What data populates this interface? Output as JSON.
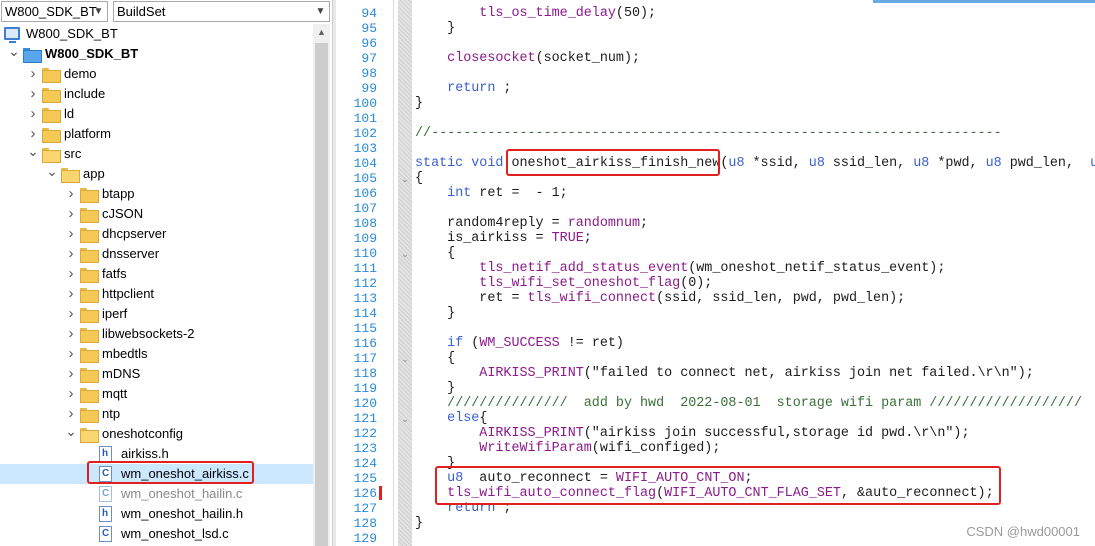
{
  "toolbar": {
    "project_combo": "W800_SDK_BT",
    "config_combo": "BuildSet"
  },
  "tree": [
    {
      "label": "W800_SDK_BT",
      "icon": "computer-icon",
      "expander": "",
      "indent": 0
    },
    {
      "label": "W800_SDK_BT",
      "icon": "project-folder-icon",
      "expander": "v",
      "indent": 0
    },
    {
      "label": "demo",
      "icon": "folder-icon",
      "expander": ">",
      "indent": 1
    },
    {
      "label": "include",
      "icon": "folder-icon",
      "expander": ">",
      "indent": 1
    },
    {
      "label": "ld",
      "icon": "folder-icon",
      "expander": ">",
      "indent": 1
    },
    {
      "label": "platform",
      "icon": "folder-icon",
      "expander": ">",
      "indent": 1
    },
    {
      "label": "src",
      "icon": "folder-open-icon",
      "expander": "v",
      "indent": 1
    },
    {
      "label": "app",
      "icon": "folder-open-icon",
      "expander": "v",
      "indent": 2
    },
    {
      "label": "btapp",
      "icon": "folder-icon",
      "expander": ">",
      "indent": 3
    },
    {
      "label": "cJSON",
      "icon": "folder-icon",
      "expander": ">",
      "indent": 3
    },
    {
      "label": "dhcpserver",
      "icon": "folder-icon",
      "expander": ">",
      "indent": 3
    },
    {
      "label": "dnsserver",
      "icon": "folder-icon",
      "expander": ">",
      "indent": 3
    },
    {
      "label": "fatfs",
      "icon": "folder-icon",
      "expander": ">",
      "indent": 3
    },
    {
      "label": "httpclient",
      "icon": "folder-icon",
      "expander": ">",
      "indent": 3
    },
    {
      "label": "iperf",
      "icon": "folder-icon",
      "expander": ">",
      "indent": 3
    },
    {
      "label": "libwebsockets-2",
      "icon": "folder-icon",
      "expander": ">",
      "indent": 3
    },
    {
      "label": "mbedtls",
      "icon": "folder-icon",
      "expander": ">",
      "indent": 3
    },
    {
      "label": "mDNS",
      "icon": "folder-icon",
      "expander": ">",
      "indent": 3
    },
    {
      "label": "mqtt",
      "icon": "folder-icon",
      "expander": ">",
      "indent": 3
    },
    {
      "label": "ntp",
      "icon": "folder-icon",
      "expander": ">",
      "indent": 3
    },
    {
      "label": "oneshotconfig",
      "icon": "folder-open-icon",
      "expander": "v",
      "indent": 3
    },
    {
      "label": "airkiss.h",
      "icon": "h-file-icon",
      "expander": "",
      "indent": 4
    },
    {
      "label": "wm_oneshot_airkiss.c",
      "icon": "c-file-icon",
      "expander": "",
      "indent": 4,
      "selected": true
    },
    {
      "label": "wm_oneshot_hailin.c",
      "icon": "c-file-muted-icon",
      "expander": "",
      "indent": 4,
      "muted": true
    },
    {
      "label": "wm_oneshot_hailin.h",
      "icon": "h-file-icon",
      "expander": "",
      "indent": 4
    },
    {
      "label": "wm_oneshot_lsd.c",
      "icon": "c-file-icon",
      "expander": "",
      "indent": 4
    }
  ],
  "editor": {
    "lines": [
      {
        "n": "94",
        "indent": "        ",
        "parts": [
          [
            "fn",
            "tls_os_time_delay"
          ],
          [
            "",
            "(50);"
          ]
        ]
      },
      {
        "n": "95",
        "indent": "    ",
        "parts": [
          [
            "",
            "}"
          ]
        ]
      },
      {
        "n": "96",
        "indent": "",
        "parts": []
      },
      {
        "n": "97",
        "indent": "    ",
        "parts": [
          [
            "fn",
            "closesocket"
          ],
          [
            "",
            "(socket_num);"
          ]
        ]
      },
      {
        "n": "98",
        "indent": "",
        "parts": []
      },
      {
        "n": "99",
        "indent": "    ",
        "parts": [
          [
            "kw",
            "return"
          ],
          [
            "",
            " ;"
          ]
        ]
      },
      {
        "n": "100",
        "indent": "",
        "parts": [
          [
            "",
            "}"
          ]
        ]
      },
      {
        "n": "101",
        "indent": "",
        "parts": []
      },
      {
        "n": "102",
        "indent": "",
        "parts": [
          [
            "cm",
            "//-----------------------------------------------------------------------"
          ]
        ]
      },
      {
        "n": "103",
        "indent": "",
        "parts": []
      },
      {
        "n": "104",
        "indent": "",
        "parts": [
          [
            "kw",
            "static void"
          ],
          [
            "",
            " oneshot_airkiss_finish_new("
          ],
          [
            "kw",
            "u8"
          ],
          [
            "",
            " *ssid, "
          ],
          [
            "kw",
            "u8"
          ],
          [
            "",
            " ssid_len, "
          ],
          [
            "kw",
            "u8"
          ],
          [
            "",
            " *pwd, "
          ],
          [
            "kw",
            "u8"
          ],
          [
            "",
            " pwd_len,  "
          ],
          [
            "kw",
            "u"
          ]
        ]
      },
      {
        "n": "105",
        "indent": "",
        "parts": [
          [
            "",
            "{"
          ]
        ]
      },
      {
        "n": "106",
        "indent": "    ",
        "parts": [
          [
            "kw",
            "int"
          ],
          [
            "",
            " ret =  - 1;"
          ]
        ]
      },
      {
        "n": "107",
        "indent": "",
        "parts": []
      },
      {
        "n": "108",
        "indent": "    ",
        "parts": [
          [
            "",
            "random4reply = "
          ],
          [
            "mac",
            "randomnum"
          ],
          [
            "",
            ";"
          ]
        ]
      },
      {
        "n": "109",
        "indent": "    ",
        "parts": [
          [
            "",
            "is_airkiss = "
          ],
          [
            "mac",
            "TRUE"
          ],
          [
            "",
            ";"
          ]
        ]
      },
      {
        "n": "110",
        "indent": "    ",
        "parts": [
          [
            "",
            "{"
          ]
        ]
      },
      {
        "n": "111",
        "indent": "        ",
        "parts": [
          [
            "fn",
            "tls_netif_add_status_event"
          ],
          [
            "",
            "(wm_oneshot_netif_status_event);"
          ]
        ]
      },
      {
        "n": "112",
        "indent": "        ",
        "parts": [
          [
            "fn",
            "tls_wifi_set_oneshot_flag"
          ],
          [
            "",
            "(0);"
          ]
        ]
      },
      {
        "n": "113",
        "indent": "        ",
        "parts": [
          [
            "",
            "ret = "
          ],
          [
            "fn",
            "tls_wifi_connect"
          ],
          [
            "",
            "(ssid, ssid_len, pwd, pwd_len);"
          ]
        ]
      },
      {
        "n": "114",
        "indent": "    ",
        "parts": [
          [
            "",
            "}"
          ]
        ]
      },
      {
        "n": "115",
        "indent": "",
        "parts": []
      },
      {
        "n": "116",
        "indent": "    ",
        "parts": [
          [
            "kw",
            "if"
          ],
          [
            "",
            " ("
          ],
          [
            "mac",
            "WM_SUCCESS"
          ],
          [
            "",
            " != ret)"
          ]
        ]
      },
      {
        "n": "117",
        "indent": "    ",
        "parts": [
          [
            "",
            "{"
          ]
        ]
      },
      {
        "n": "118",
        "indent": "        ",
        "parts": [
          [
            "mac",
            "AIRKISS_PRINT"
          ],
          [
            "",
            "(\"failed to connect net, airkiss join net failed.\\r\\n\");"
          ]
        ]
      },
      {
        "n": "119",
        "indent": "    ",
        "parts": [
          [
            "",
            "}"
          ]
        ]
      },
      {
        "n": "120",
        "indent": "    ",
        "parts": [
          [
            "cm",
            "///////////////  add by hwd  2022-08-01  storage wifi param ///////////////////"
          ]
        ]
      },
      {
        "n": "121",
        "indent": "    ",
        "parts": [
          [
            "kw",
            "else"
          ],
          [
            "",
            "{"
          ]
        ]
      },
      {
        "n": "122",
        "indent": "        ",
        "parts": [
          [
            "mac",
            "AIRKISS_PRINT"
          ],
          [
            "",
            "(\"airkiss join successful,storage id pwd.\\r\\n\");"
          ]
        ]
      },
      {
        "n": "123",
        "indent": "        ",
        "parts": [
          [
            "fn",
            "WriteWifiParam"
          ],
          [
            "",
            "(wifi_configed);"
          ]
        ]
      },
      {
        "n": "124",
        "indent": "    ",
        "parts": [
          [
            "",
            "}"
          ]
        ]
      },
      {
        "n": "125",
        "indent": "    ",
        "parts": [
          [
            "kw",
            "u8"
          ],
          [
            "",
            "  auto_reconnect = "
          ],
          [
            "mac",
            "WIFI_AUTO_CNT_ON"
          ],
          [
            "",
            ";"
          ]
        ]
      },
      {
        "n": "126",
        "indent": "    ",
        "parts": [
          [
            "fn",
            "tls_wifi_auto_connect_flag"
          ],
          [
            "",
            "("
          ],
          [
            "mac",
            "WIFI_AUTO_CNT_FLAG_SET"
          ],
          [
            "",
            ", &auto_reconnect);"
          ]
        ]
      },
      {
        "n": "127",
        "indent": "    ",
        "parts": [
          [
            "kw",
            "return"
          ],
          [
            "",
            " ;"
          ]
        ]
      },
      {
        "n": "128",
        "indent": "",
        "parts": [
          [
            "",
            "}"
          ]
        ]
      },
      {
        "n": "129",
        "indent": "",
        "parts": []
      }
    ]
  },
  "watermark": "CSDN @hwd00001",
  "colors": {
    "highlight_box": "#e02020",
    "selection": "#cce8ff",
    "line_number": "#2b8ad8",
    "keyword": "#3a5fd0"
  }
}
